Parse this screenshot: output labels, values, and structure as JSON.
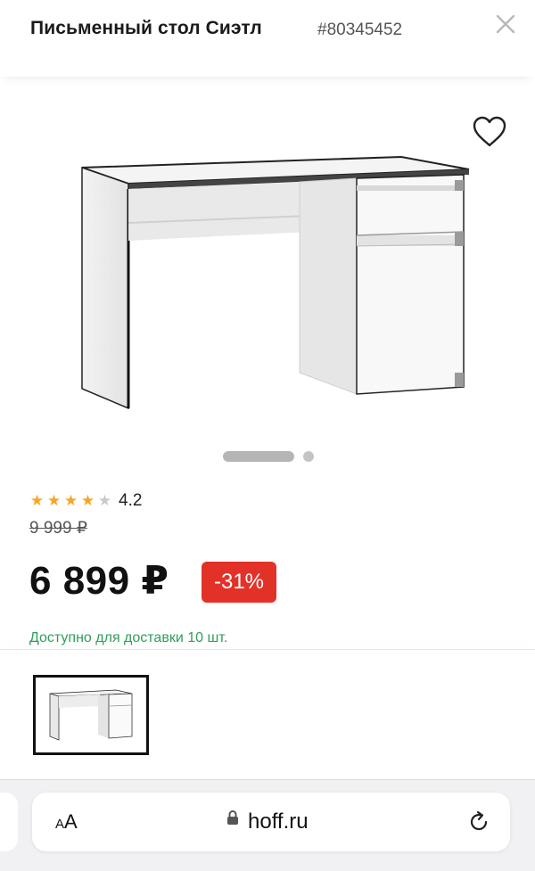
{
  "header": {
    "title": "Письменный стол Сиэтл",
    "sku": "#80345452",
    "close_icon": "close-icon"
  },
  "gallery": {
    "favorite_icon": "heart-outline-icon",
    "pages": 2,
    "active_page": 1
  },
  "product": {
    "rating": {
      "stars_filled": 4,
      "stars_total": 5,
      "value": "4.2",
      "star_color": "#f5a623"
    },
    "old_price": "9 999 ₽",
    "price": "6 899 ₽",
    "discount": "-31%",
    "discount_color": "#e23228",
    "availability": "Доступно для доставки 10 шт.",
    "availability_color": "#2f9e5b"
  },
  "browser": {
    "aa_label_small": "A",
    "aa_label_large": "A",
    "url": "hoff.ru",
    "lock_icon": "lock-icon",
    "reload_icon": "reload-icon"
  }
}
